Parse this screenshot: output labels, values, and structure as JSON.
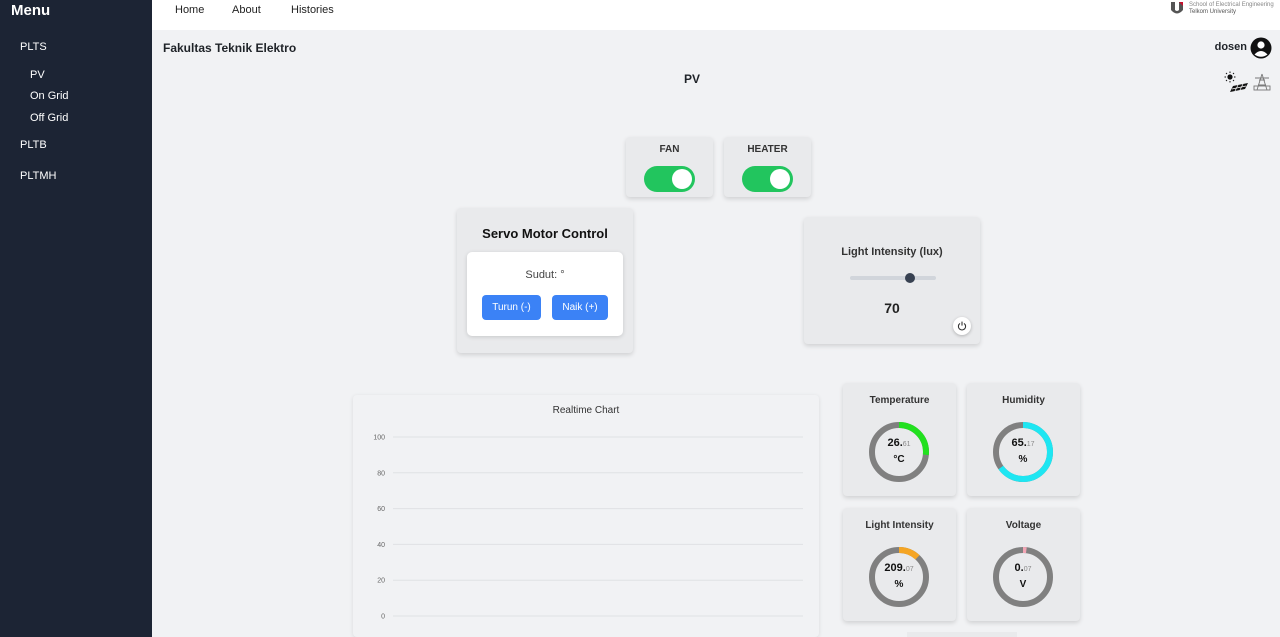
{
  "sidebar": {
    "title": "Menu",
    "items": [
      {
        "label": "PLTS"
      },
      {
        "label": "PV"
      },
      {
        "label": "On Grid"
      },
      {
        "label": "Off Grid"
      },
      {
        "label": "PLTB"
      },
      {
        "label": "PLTMH"
      }
    ]
  },
  "nav": {
    "home": "Home",
    "about": "About",
    "histories": "Histories"
  },
  "logo": {
    "line1": "School of Electrical Engineering",
    "line2": "Telkom University"
  },
  "header": {
    "faculty": "Fakultas Teknik Elektro",
    "user": "dosen",
    "page_title": "PV"
  },
  "switches": {
    "fan": {
      "label": "FAN",
      "on": true
    },
    "heater": {
      "label": "HEATER",
      "on": true
    }
  },
  "servo": {
    "title": "Servo Motor Control",
    "angle_label": "Sudut: °",
    "down_label": "Turun (-)",
    "up_label": "Naik (+)"
  },
  "light_control": {
    "title": "Light Intensity (lux)",
    "value": "70",
    "slider_fraction": 0.7
  },
  "chart_data": {
    "type": "line",
    "title": "Realtime Chart",
    "yticks": [
      "100",
      "80",
      "60",
      "40",
      "20",
      "0"
    ],
    "ylim": [
      0,
      100
    ],
    "series": [],
    "grid": true
  },
  "gauges": {
    "temperature": {
      "label": "Temperature",
      "value": "26.",
      "decimals": "61",
      "unit": "°C",
      "fraction": 0.2661,
      "color": "#22e01f"
    },
    "humidity": {
      "label": "Humidity",
      "value": "65.",
      "decimals": "17",
      "unit": "%",
      "fraction": 0.6517,
      "color": "#1ee6f2"
    },
    "light": {
      "label": "Light Intensity",
      "value": "209.",
      "decimals": "07",
      "unit": "%",
      "fraction": 0.12,
      "color": "#f5a524"
    },
    "voltage": {
      "label": "Voltage",
      "value": "0.",
      "decimals": "07",
      "unit": "V",
      "fraction": 0.005,
      "color": "#f3a6b5"
    }
  },
  "colors": {
    "sidebar_bg": "#1c2434",
    "accent_blue": "#3b82f6",
    "toggle_on": "#22c55e",
    "gauge_track": "#808080"
  }
}
